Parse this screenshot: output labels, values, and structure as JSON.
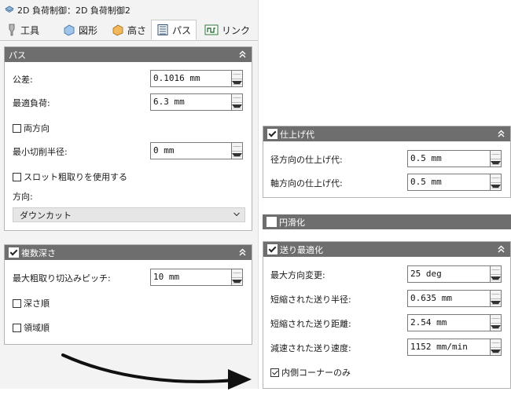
{
  "window": {
    "title": "2D 負荷制御：2D 負荷制御2"
  },
  "tabs": [
    {
      "label": "工具",
      "icon": "tool-icon"
    },
    {
      "label": "図形",
      "icon": "shape-icon"
    },
    {
      "label": "高さ",
      "icon": "height-icon"
    },
    {
      "label": "パス",
      "icon": "path-icon",
      "active": true
    },
    {
      "label": "リンク",
      "icon": "link-icon"
    }
  ],
  "path_panel": {
    "title": "パス",
    "tolerance_label": "公差:",
    "tolerance_value": "0.1016 mm",
    "optimal_load_label": "最適負荷:",
    "optimal_load_value": "6.3 mm",
    "both_directions_label": "両方向",
    "min_radius_label": "最小切削半径:",
    "min_radius_value": "0 mm",
    "slot_roughing_label": "スロット粗取りを使用する",
    "direction_label": "方向:",
    "direction_value": "ダウンカット"
  },
  "multi_depth_panel": {
    "title": "複数深さ",
    "max_step_label": "最大粗取り切込みピッチ:",
    "max_step_value": "10 mm",
    "depth_order_label": "深さ順",
    "region_order_label": "領域順"
  },
  "stock_panel": {
    "title": "仕上げ代",
    "radial_label": "径方向の仕上げ代:",
    "radial_value": "0.5 mm",
    "axial_label": "軸方向の仕上げ代:",
    "axial_value": "0.5 mm"
  },
  "smoothing_panel": {
    "title": "円滑化"
  },
  "feed_opt_panel": {
    "title": "送り最適化",
    "max_dir_change_label": "最大方向変更:",
    "max_dir_change_value": "25 deg",
    "reduced_radius_label": "短縮された送り半径:",
    "reduced_radius_value": "0.635 mm",
    "reduced_distance_label": "短縮された送り距離:",
    "reduced_distance_value": "2.54 mm",
    "reduced_feed_label": "減速された送り速度:",
    "reduced_feed_value": "1152 mm/min",
    "inner_corners_label": "内側コーナーのみ"
  }
}
